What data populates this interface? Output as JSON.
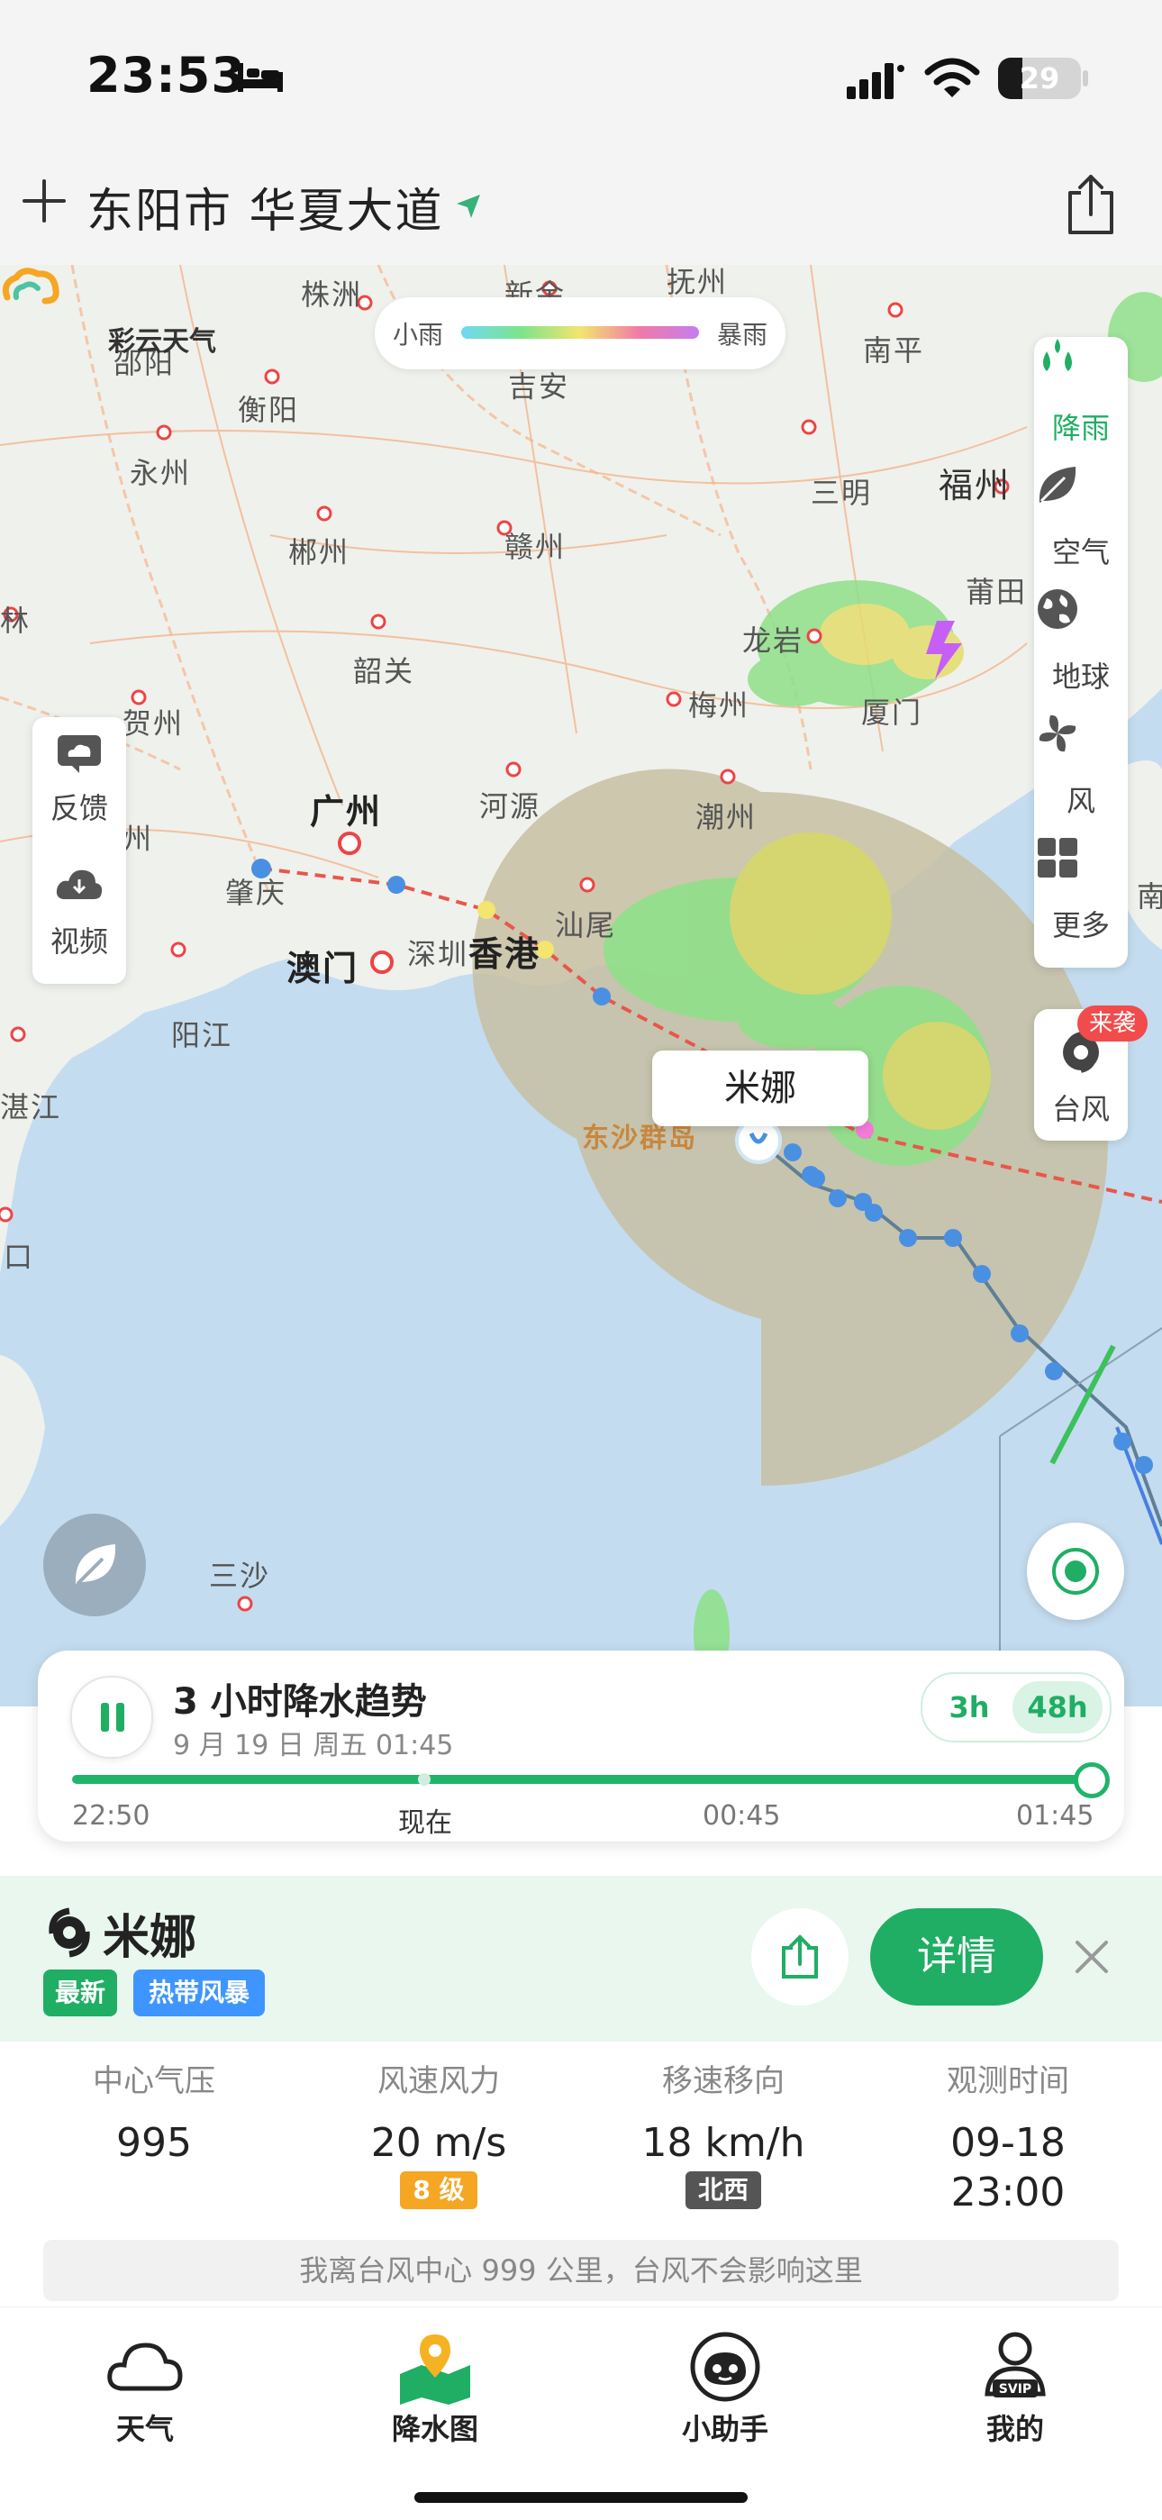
{
  "status_bar": {
    "time": "23:53",
    "battery": "29",
    "battery_level": 0.29
  },
  "header": {
    "location": "东阳市 华夏大道"
  },
  "map": {
    "brand": "彩云天气",
    "legend": {
      "low": "小雨",
      "high": "暴雨"
    },
    "side_panel": [
      {
        "label": "降雨",
        "icon": "rain-drops-icon"
      },
      {
        "label": "空气",
        "icon": "leaf-icon"
      },
      {
        "label": "地球",
        "icon": "globe-icon"
      },
      {
        "label": "风",
        "icon": "fan-icon"
      },
      {
        "label": "更多",
        "icon": "grid-icon"
      }
    ],
    "typhoon_button": {
      "label": "台风",
      "badge": "来袭"
    },
    "left_panel": [
      {
        "label": "反馈",
        "icon": "cloud-feedback-icon"
      },
      {
        "label": "视频",
        "icon": "cloud-download-icon"
      }
    ],
    "storm_label": "米娜",
    "cities": [
      {
        "name": "株洲"
      },
      {
        "name": "新余"
      },
      {
        "name": "抚州"
      },
      {
        "name": "邵阳"
      },
      {
        "name": "衡阳"
      },
      {
        "name": "吉安"
      },
      {
        "name": "南平"
      },
      {
        "name": "永州"
      },
      {
        "name": "三明"
      },
      {
        "name": "福州"
      },
      {
        "name": "郴州"
      },
      {
        "name": "赣州"
      },
      {
        "name": "莆田"
      },
      {
        "name": "林"
      },
      {
        "name": "龙岩"
      },
      {
        "name": "韶关"
      },
      {
        "name": "贺州"
      },
      {
        "name": "梅州"
      },
      {
        "name": "厦门"
      },
      {
        "name": "广州"
      },
      {
        "name": "河源"
      },
      {
        "name": "潮州"
      },
      {
        "name": "州"
      },
      {
        "name": "肇庆"
      },
      {
        "name": "汕尾"
      },
      {
        "name": "澳门"
      },
      {
        "name": "深圳"
      },
      {
        "name": "香港"
      },
      {
        "name": "阳江"
      },
      {
        "name": "湛江"
      },
      {
        "name": "东沙群岛"
      },
      {
        "name": "三沙"
      },
      {
        "name": "口"
      },
      {
        "name": "南"
      }
    ]
  },
  "playback": {
    "title": "3 小时降水趋势",
    "date": "9 月 19 日 周五 01:45",
    "range_3h": "3h",
    "range_48h": "48h",
    "progress": 1.0,
    "labels": [
      "22:50",
      "现在",
      "00:45",
      "01:45"
    ]
  },
  "typhoon": {
    "name": "米娜",
    "tags": [
      "最新",
      "热带风暴"
    ],
    "detail_label": "详情",
    "stats": [
      {
        "label": "中心气压",
        "value": "995"
      },
      {
        "label": "风速风力",
        "value": "20 m/s",
        "badge": "8 级",
        "badge_color": "#f5a623"
      },
      {
        "label": "移速移向",
        "value": "18 km/h",
        "badge": "北西",
        "badge_color": "#555555"
      },
      {
        "label": "观测时间",
        "value": "09-18",
        "value2": "23:00"
      }
    ],
    "notice": "我离台风中心 999 公里，台风不会影响这里"
  },
  "tabbar": [
    {
      "label": "天气",
      "icon": "cloud-icon"
    },
    {
      "label": "降水图",
      "icon": "map-pin-icon"
    },
    {
      "label": "小助手",
      "icon": "assistant-icon"
    },
    {
      "label": "我的",
      "icon": "svip-profile-icon"
    }
  ],
  "colors": {
    "accent": "#1fae64",
    "track_red": "#e8574a",
    "track_blue": "#4a90e2",
    "badge_red": "#f24b4b"
  }
}
